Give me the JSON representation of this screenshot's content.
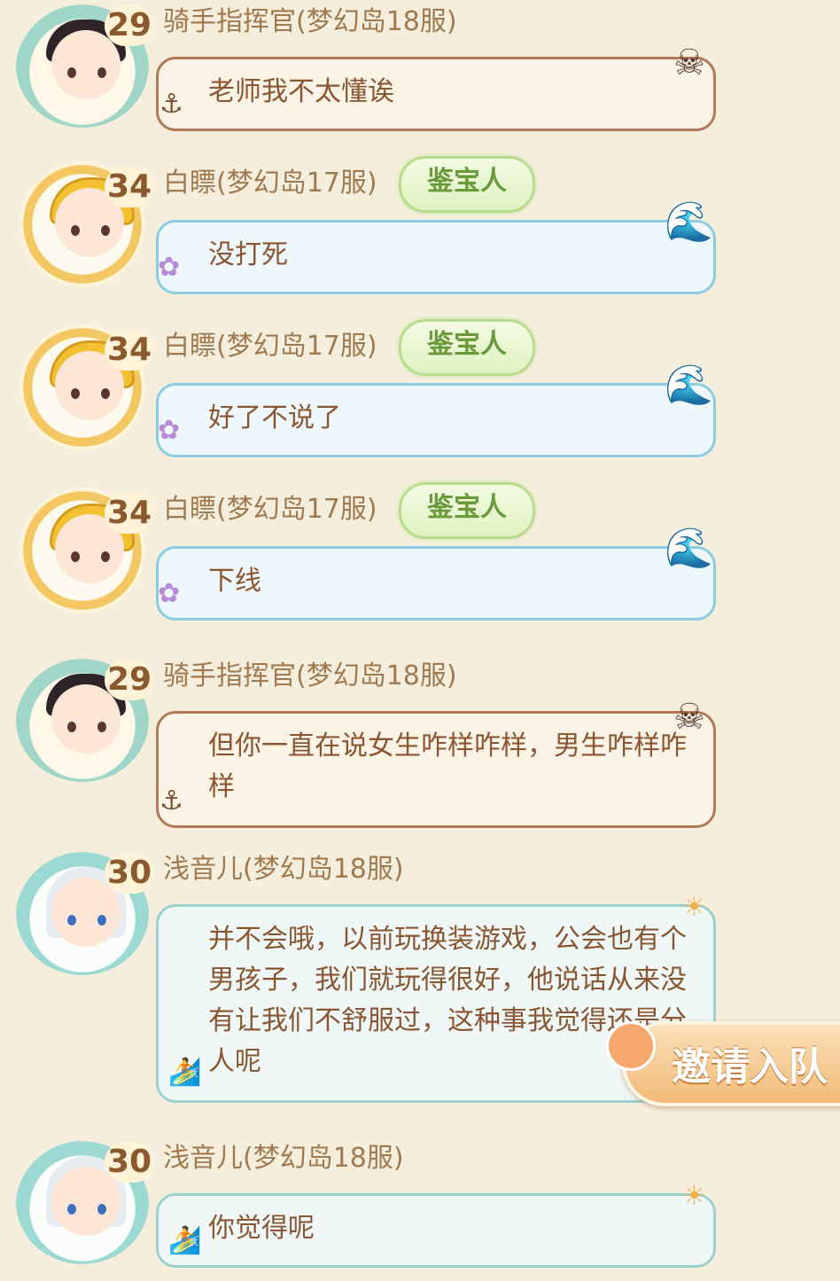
{
  "messages": [
    {
      "level": "29",
      "name": "骑手指挥官(梦幻岛18服)",
      "badge": "",
      "text": "老师我不太懂诶"
    },
    {
      "level": "34",
      "name": "白瞟(梦幻岛17服)",
      "badge": "鉴宝人",
      "text": "没打死"
    },
    {
      "level": "34",
      "name": "白瞟(梦幻岛17服)",
      "badge": "鉴宝人",
      "text": "好了不说了"
    },
    {
      "level": "34",
      "name": "白瞟(梦幻岛17服)",
      "badge": "鉴宝人",
      "text": "下线"
    },
    {
      "level": "29",
      "name": "骑手指挥官(梦幻岛18服)",
      "badge": "",
      "text": "但你一直在说女生咋样咋样，男生咋样咋样"
    },
    {
      "level": "30",
      "name": "浅音儿(梦幻岛18服)",
      "badge": "",
      "text": "并不会哦，以前玩换装游戏，公会也有个男孩子，我们就玩得很好，他说话从来没有让我们不舒服过，这种事我觉得还是分人呢"
    },
    {
      "level": "30",
      "name": "浅音儿(梦幻岛18服)",
      "badge": "",
      "text": "你觉得呢"
    }
  ],
  "invite_button": "邀请入队"
}
